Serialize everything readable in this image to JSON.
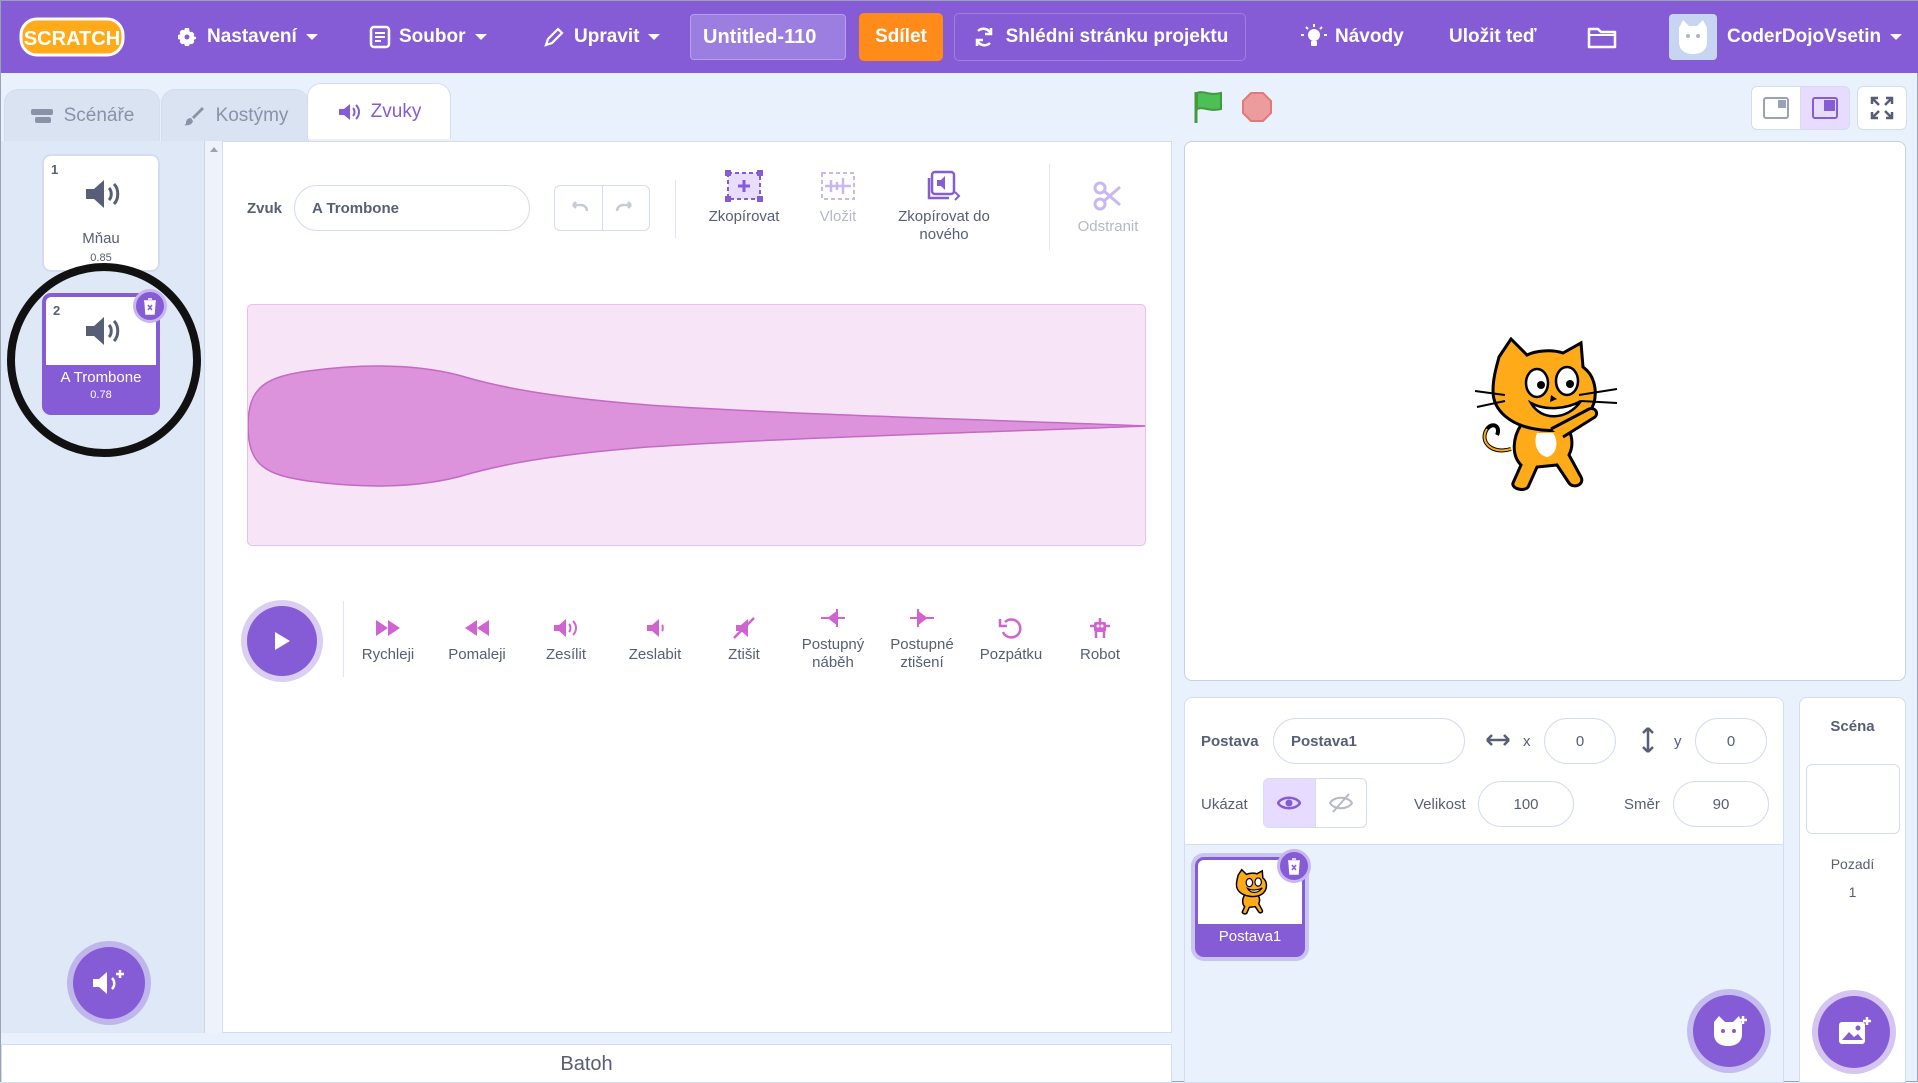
{
  "menubar": {
    "logo": "SCRATCH",
    "settings": "Nastavení",
    "file": "Soubor",
    "edit": "Upravit",
    "project_title": "Untitled-110",
    "share": "Sdílet",
    "see_project_page": "Shlédni stránku projektu",
    "tutorials": "Návody",
    "save_now": "Uložit teď",
    "username": "CoderDojoVsetin"
  },
  "tabs": {
    "code": "Scénáře",
    "costumes": "Kostýmy",
    "sounds": "Zvuky"
  },
  "sounds": [
    {
      "index": "1",
      "name": "Mňau",
      "duration": "0.85"
    },
    {
      "index": "2",
      "name": "A Trombone",
      "duration": "0.78"
    }
  ],
  "editor": {
    "sound_label": "Zvuk",
    "sound_name": "A Trombone",
    "copy": "Zkopírovat",
    "paste": "Vložit",
    "copy_to_new": "Zkopírovat do nového",
    "delete": "Odstranit",
    "effects": [
      "Rychleji",
      "Pomaleji",
      "Zesílit",
      "Zeslabit",
      "Ztišit",
      "Postupný náběh",
      "Postupné ztišení",
      "Pozpátku",
      "Robot"
    ]
  },
  "backpack": "Batoh",
  "sprite_info": {
    "sprite_label": "Postava",
    "sprite_name": "Postava1",
    "x_label": "x",
    "x": "0",
    "y_label": "y",
    "y": "0",
    "show_label": "Ukázat",
    "size_label": "Velikost",
    "size": "100",
    "direction_label": "Směr",
    "direction": "90"
  },
  "sprites": [
    {
      "name": "Postava1"
    }
  ],
  "stage_pane": {
    "title": "Scéna",
    "backdrops_label": "Pozadí",
    "backdrops_count": "1"
  },
  "colors": {
    "accent": "#855cd6",
    "share": "#ff8c1a",
    "wave": "#d27ed6"
  }
}
